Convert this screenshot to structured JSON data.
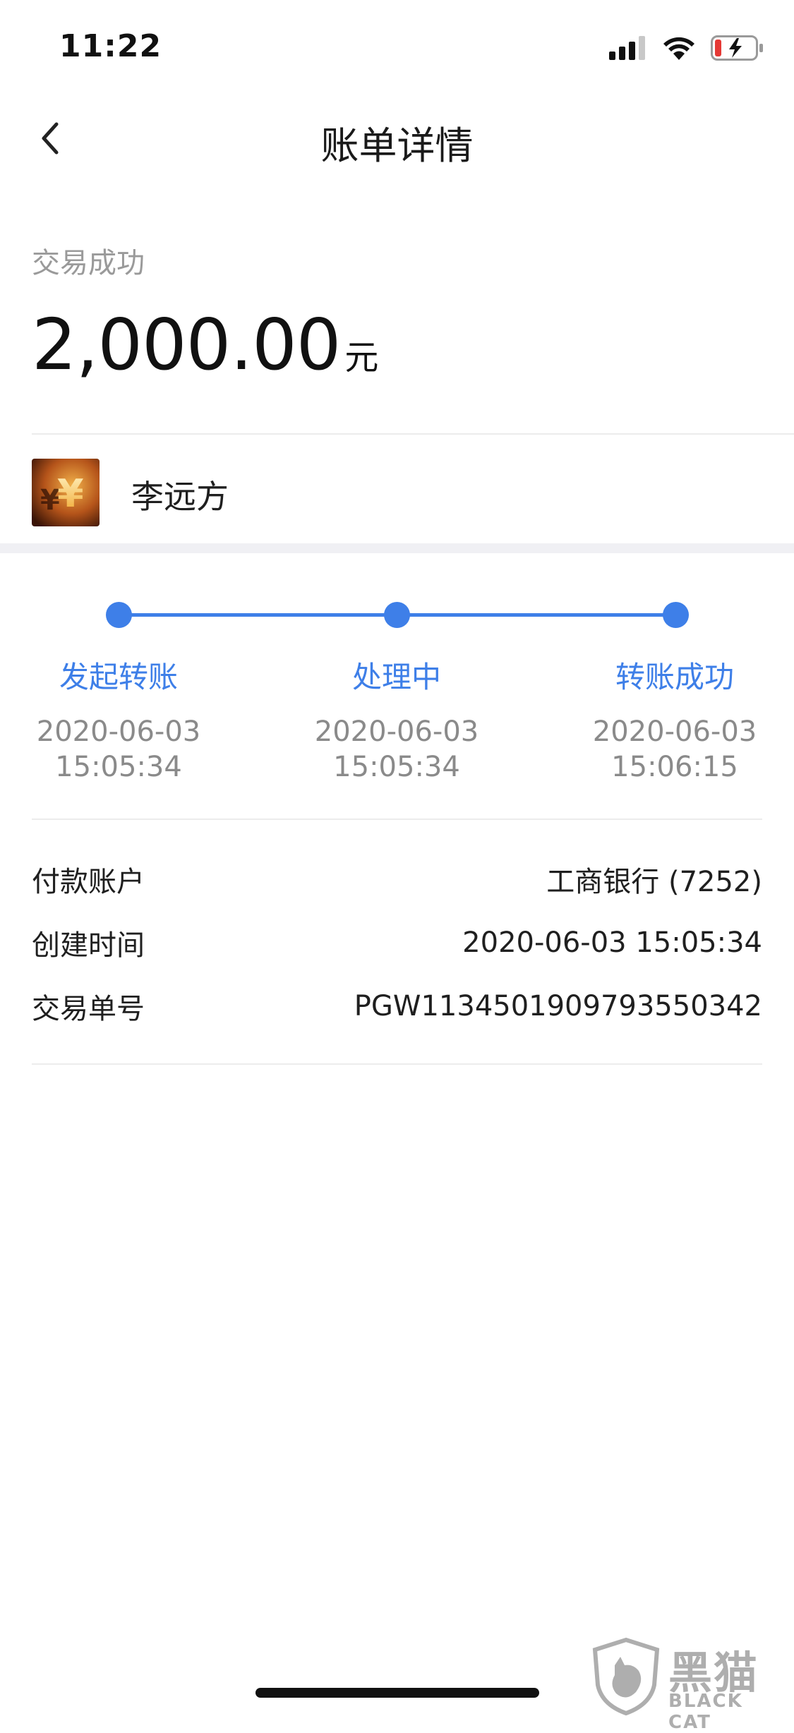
{
  "status_bar": {
    "time": "11:22",
    "icons": [
      "cellular-signal-icon",
      "wifi-icon",
      "battery-charging-icon"
    ],
    "battery_color": "#e53935"
  },
  "nav": {
    "back_icon": "chevron-left-icon",
    "title": "账单详情"
  },
  "transaction": {
    "status": "交易成功",
    "amount": "2,000.00",
    "unit": "元"
  },
  "payee": {
    "avatar_icon": "yuan-coin-avatar",
    "name": "李远方"
  },
  "progress": {
    "accent_color": "#3e7fe8",
    "steps": [
      {
        "label": "发起转账",
        "date": "2020-06-03",
        "time": "15:05:34"
      },
      {
        "label": "处理中",
        "date": "2020-06-03",
        "time": "15:05:34"
      },
      {
        "label": "转账成功",
        "date": "2020-06-03",
        "time": "15:06:15"
      }
    ]
  },
  "details": [
    {
      "label": "付款账户",
      "value": "工商银行 (7252)"
    },
    {
      "label": "创建时间",
      "value": "2020-06-03 15:05:34"
    },
    {
      "label": "交易单号",
      "value": "PGW1134501909793550342"
    }
  ],
  "watermark": {
    "text_cn": "黑猫",
    "text_en": "BLACK CAT"
  }
}
